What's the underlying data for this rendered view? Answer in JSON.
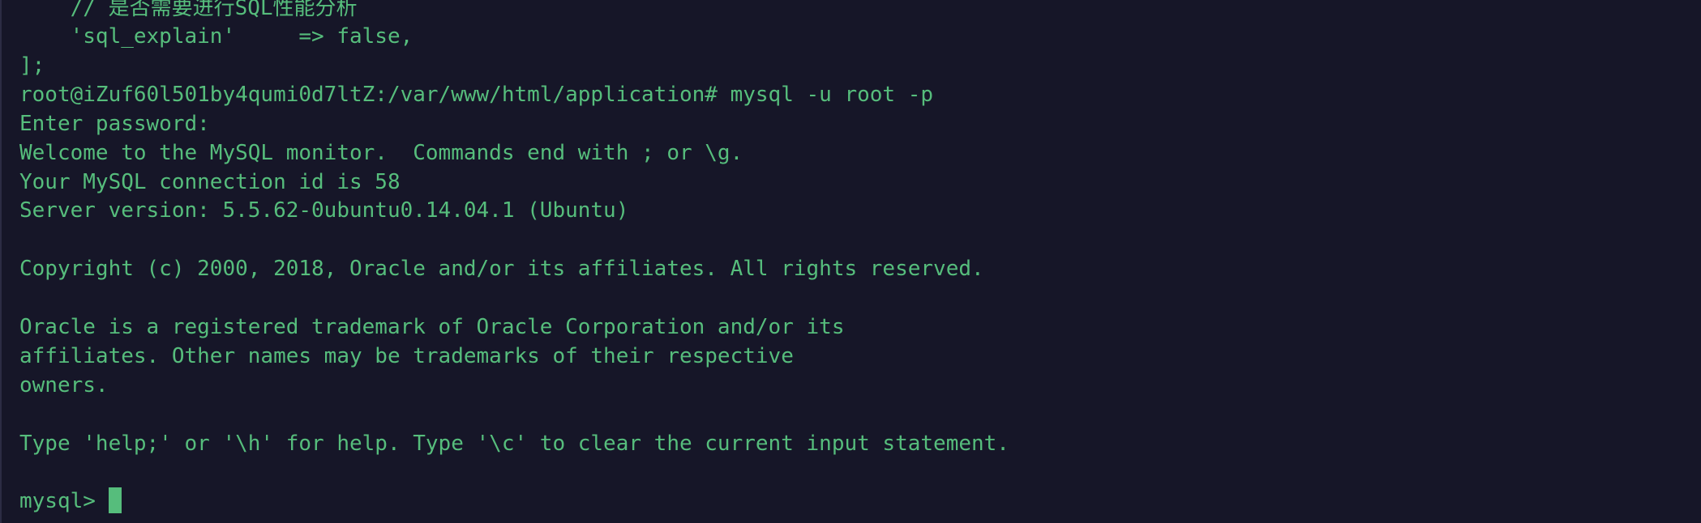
{
  "terminal": {
    "lines": [
      "    // 是否需要进行SQL性能分析",
      "    'sql_explain'     => false,",
      "];",
      "root@iZuf60l501by4qumi0d7ltZ:/var/www/html/application# mysql -u root -p",
      "Enter password:",
      "Welcome to the MySQL monitor.  Commands end with ; or \\g.",
      "Your MySQL connection id is 58",
      "Server version: 5.5.62-0ubuntu0.14.04.1 (Ubuntu)",
      "",
      "Copyright (c) 2000, 2018, Oracle and/or its affiliates. All rights reserved.",
      "",
      "Oracle is a registered trademark of Oracle Corporation and/or its",
      "affiliates. Other names may be trademarks of their respective",
      "owners.",
      "",
      "Type 'help;' or '\\h' for help. Type '\\c' to clear the current input statement.",
      ""
    ],
    "prompt": "mysql> "
  },
  "colors": {
    "background": "#161628",
    "text": "#56bd7c",
    "cursor": "#56bd7c"
  }
}
